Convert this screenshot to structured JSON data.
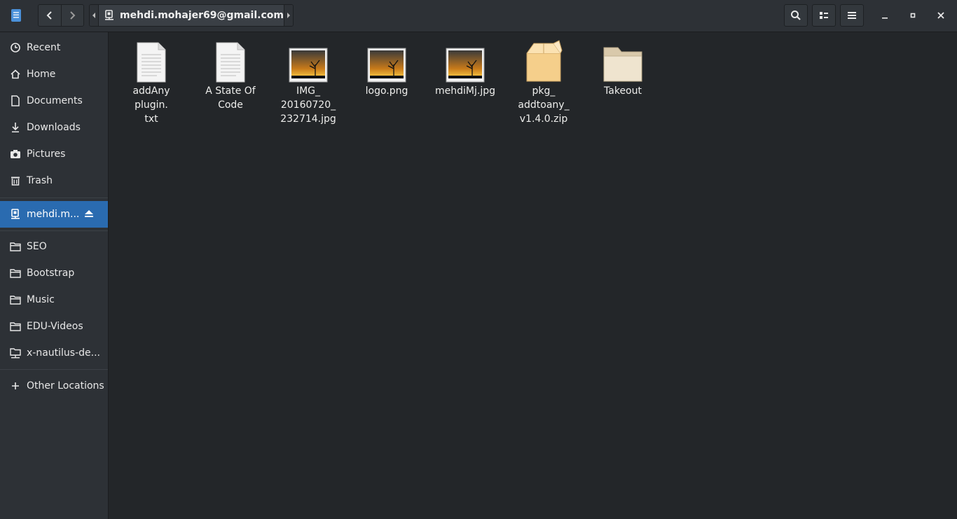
{
  "header": {
    "location_label": "mehdi.mohajer69@gmail.com"
  },
  "sidebar": {
    "places": [
      {
        "label": "Recent",
        "icon": "clock-icon"
      },
      {
        "label": "Home",
        "icon": "home-icon"
      },
      {
        "label": "Documents",
        "icon": "document-icon"
      },
      {
        "label": "Downloads",
        "icon": "download-icon"
      },
      {
        "label": "Pictures",
        "icon": "camera-icon"
      },
      {
        "label": "Trash",
        "icon": "trash-icon"
      }
    ],
    "mounts": [
      {
        "label": "mehdi.m...",
        "icon": "network-drive-icon"
      }
    ],
    "bookmarks": [
      {
        "label": "SEO",
        "icon": "folder-icon"
      },
      {
        "label": "Bootstrap",
        "icon": "folder-icon"
      },
      {
        "label": "Music",
        "icon": "folder-icon"
      },
      {
        "label": "EDU-Videos",
        "icon": "folder-icon"
      },
      {
        "label": "x-nautilus-de...",
        "icon": "network-folder-icon"
      }
    ],
    "other": {
      "label": "Other Locations",
      "icon": "plus-icon"
    }
  },
  "files": [
    {
      "name": "addAny plugin.\ntxt",
      "type": "text"
    },
    {
      "name": "A State Of\nCode",
      "type": "text"
    },
    {
      "name": "IMG_\n20160720_\n232714.jpg",
      "type": "image"
    },
    {
      "name": "logo.png",
      "type": "image"
    },
    {
      "name": "mehdiMj.jpg",
      "type": "image"
    },
    {
      "name": "pkg_\naddtoany_\nv1.4.0.zip",
      "type": "archive"
    },
    {
      "name": "Takeout",
      "type": "folder"
    }
  ],
  "colors": {
    "background": "#232629",
    "sidebar": "#2d3136",
    "accent": "#2a6bb0"
  }
}
